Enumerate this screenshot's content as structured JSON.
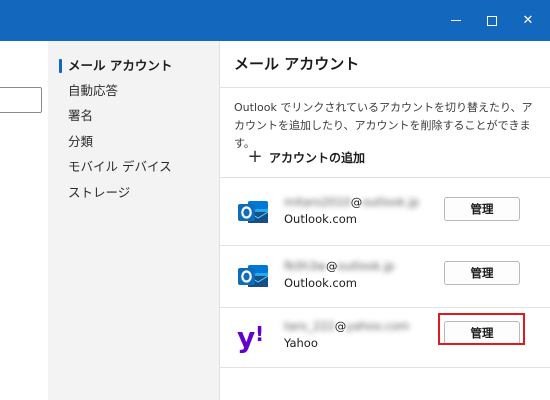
{
  "window": {
    "minimize_glyph": "minimize-icon",
    "maximize_glyph": "maximize-icon",
    "close_glyph": "✕"
  },
  "nav": {
    "items": [
      {
        "label": "メール アカウント",
        "active": true
      },
      {
        "label": "自動応答",
        "active": false
      },
      {
        "label": "署名",
        "active": false
      },
      {
        "label": "分類",
        "active": false
      },
      {
        "label": "モバイル デバイス",
        "active": false
      },
      {
        "label": "ストレージ",
        "active": false
      }
    ]
  },
  "content": {
    "title": "メール アカウント",
    "description": "Outlook でリンクされているアカウントを切り替えたり、アカウントを追加したり、アカウントを削除することができます。",
    "add_account_label": "アカウントの追加",
    "manage_label": "管理",
    "accounts": [
      {
        "user": "mitaro2010",
        "at": "@",
        "domain": "outlook.jp",
        "provider": "Outlook.com",
        "icon": "outlook-icon"
      },
      {
        "user": "fk0h3w",
        "at": "@",
        "domain": "outlook.jp",
        "provider": "Outlook.com",
        "icon": "outlook-icon"
      },
      {
        "user": "taro_222",
        "at": "@",
        "domain": "yahoo.com",
        "provider": "Yahoo",
        "icon": "yahoo-icon"
      }
    ]
  },
  "colors": {
    "titlebar": "#1368bd",
    "highlight": "#e0191f",
    "yahoo": "#6001d2",
    "outlook": "#0f6cbd"
  }
}
